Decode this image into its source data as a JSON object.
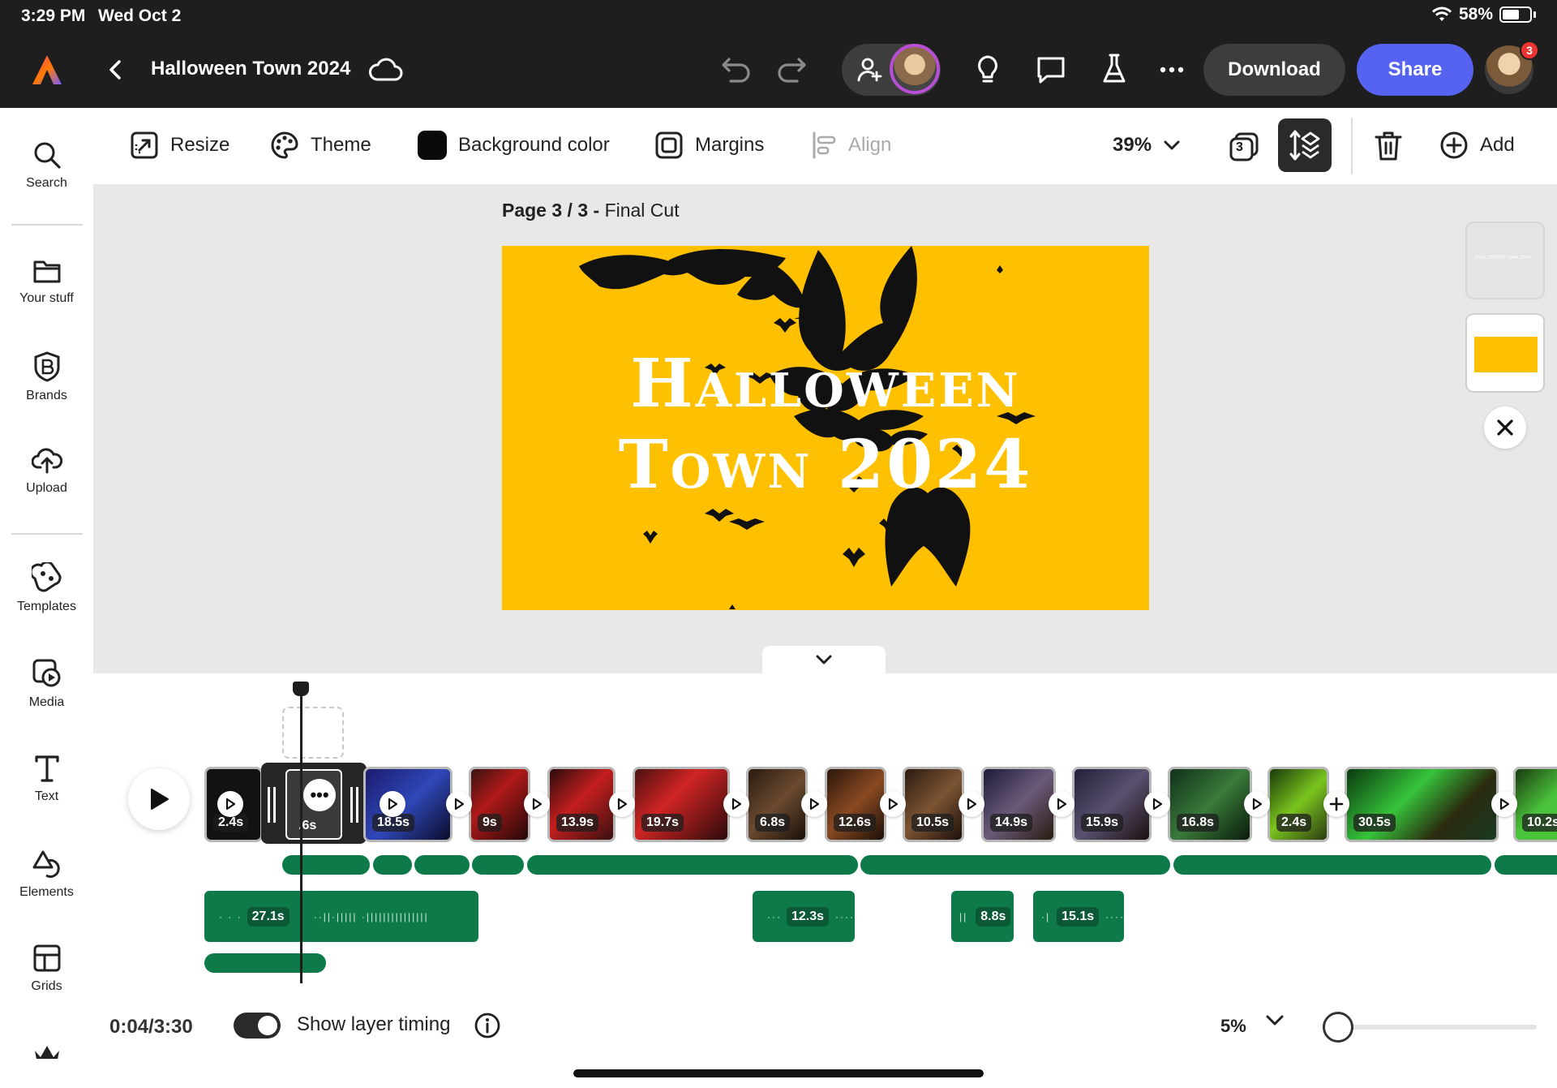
{
  "status_bar": {
    "time": "3:29 PM",
    "date": "Wed Oct 2",
    "battery": "58%"
  },
  "header": {
    "doc_title": "Halloween Town 2024",
    "download_label": "Download",
    "share_label": "Share",
    "notification_count": "3",
    "accent": "#5563f0"
  },
  "sidebar": {
    "items": [
      {
        "label": "Search",
        "icon": "search-icon"
      },
      {
        "label": "Your stuff",
        "icon": "folder-icon"
      },
      {
        "label": "Brands",
        "icon": "brand-icon"
      },
      {
        "label": "Upload",
        "icon": "upload-icon"
      },
      {
        "label": "Templates",
        "icon": "templates-icon"
      },
      {
        "label": "Media",
        "icon": "media-icon"
      },
      {
        "label": "Text",
        "icon": "text-icon"
      },
      {
        "label": "Elements",
        "icon": "elements-icon"
      },
      {
        "label": "Grids",
        "icon": "grids-icon"
      }
    ]
  },
  "toolbar": {
    "resize": "Resize",
    "theme": "Theme",
    "background_color": "Background color",
    "margins": "Margins",
    "align": "Align",
    "zoom": "39%",
    "page_count": "3",
    "add": "Add"
  },
  "canvas": {
    "page_label_prefix": "Page 3 / 3 -",
    "page_name": "Final Cut",
    "title_line1": "Halloween",
    "title_line2": "Town 2024",
    "bg_color": "#ffc000"
  },
  "thumbnails": {
    "thumb1_text": "HALLOWEEN Town 2024"
  },
  "timeline": {
    "clips": [
      "2.4s",
      ".6s",
      "18.5s",
      "9s",
      "13.9s",
      "19.7s",
      "6.8s",
      "12.6s",
      "10.5s",
      "14.9s",
      "15.9s",
      "16.8s",
      "2.4s",
      "30.5s",
      "10.2s"
    ],
    "audio": [
      "27.1s",
      "12.3s",
      "8.8s",
      "15.1s"
    ],
    "time_readout": "0:04/3:30",
    "show_layer_timing": "Show layer timing",
    "zoom": "5%",
    "track_color": "#0e7a4a"
  }
}
